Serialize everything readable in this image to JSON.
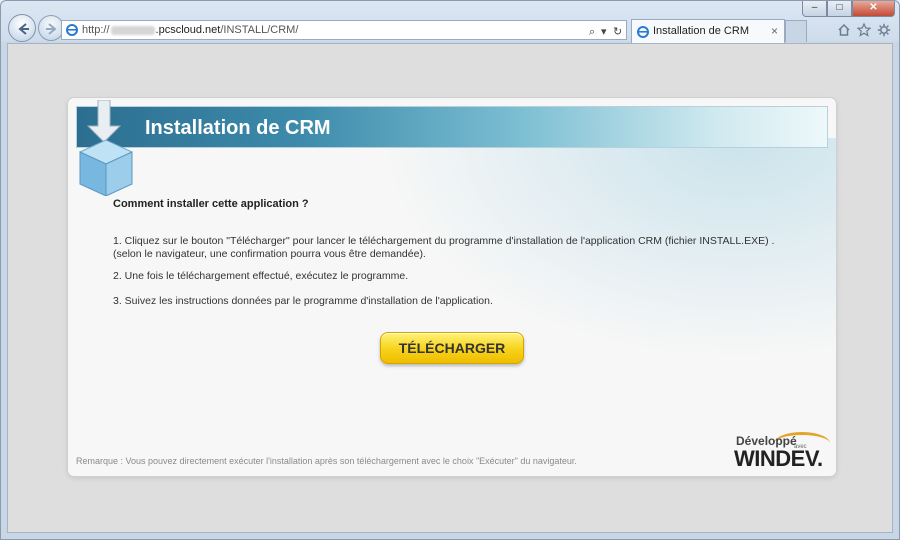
{
  "browser": {
    "url_prefix": "http://",
    "url_host": ".pcscloud.net",
    "url_path": "/INSTALL/CRM/",
    "search_symbol": "⌕",
    "dropdown_symbol": "▾",
    "refresh_symbol": "↻",
    "tab_title": "Installation de CRM",
    "tab_close": "×",
    "window_buttons": {
      "minimize": "–",
      "maximize": "□",
      "close": "✕"
    },
    "tool_icons": [
      "home-icon",
      "favorites-star-icon",
      "settings-gear-icon"
    ]
  },
  "page": {
    "banner_title": "Installation de CRM",
    "question": "Comment installer cette application ?",
    "steps": [
      "1. Cliquez sur le bouton \"Télécharger\" pour lancer le téléchargement du programme d'installation de l'application CRM (fichier INSTALL.EXE) .",
      "(selon le navigateur, une confirmation pourra vous être demandée).",
      "2. Une fois le téléchargement effectué, exécutez le programme.",
      "3. Suivez les instructions données par le programme d'installation de l'application."
    ],
    "download_button": "TÉLÉCHARGER",
    "remark": "Remarque : Vous pouvez directement exécuter l'installation après son téléchargement avec le choix \"Exécuter\" du navigateur.",
    "logo": {
      "developpe": "Développé",
      "avec": "avec",
      "brand": "WINDEV."
    }
  },
  "colors": {
    "banner_dark": "#2c6e90",
    "button_yellow": "#f7d21a",
    "logo_arc": "#e2a42a"
  }
}
